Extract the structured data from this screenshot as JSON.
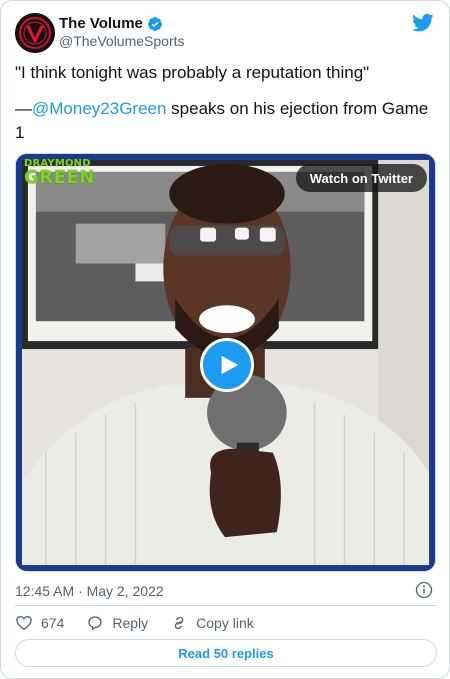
{
  "author": {
    "name": "The Volume",
    "handle": "@TheVolumeSports",
    "verified": true
  },
  "tweet": {
    "line1": "\"I think tonight was probably a reputation thing\"",
    "dash": "—",
    "mention": "@Money23Green",
    "line2_rest": " speaks on his ejection from Game 1"
  },
  "media": {
    "brand_top": "DRAYMOND",
    "brand_bottom": "GREEN",
    "watch_label": "Watch on Twitter",
    "play_icon": "play-icon"
  },
  "meta": {
    "timestamp": "12:45 AM · May 2, 2022"
  },
  "actions": {
    "like_count": "674",
    "reply_label": "Reply",
    "copy_label": "Copy link"
  },
  "footer": {
    "read_replies": "Read 50 replies"
  },
  "colors": {
    "accent": "#1d9bf0",
    "muted": "#536471",
    "border": "#cfd9de",
    "media_frame": "#1a3b8c",
    "brand_green": "#7dd321"
  }
}
